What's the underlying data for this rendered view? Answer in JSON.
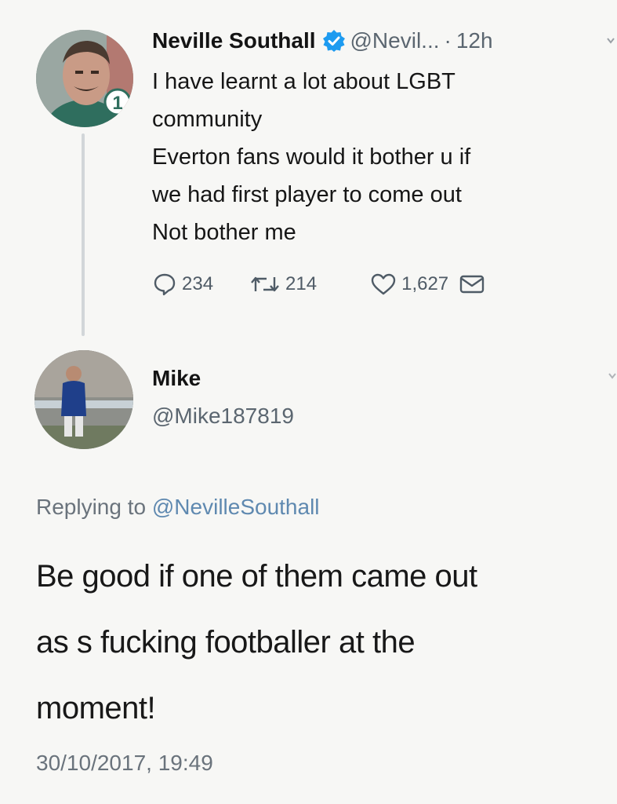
{
  "original_tweet": {
    "display_name": "Neville Southall",
    "handle": "@Nevil...",
    "separator": "·",
    "age": "12h",
    "verified_icon": "verified-badge-icon",
    "body_lines": [
      "I have learnt a lot about LGBT",
      "community",
      "Everton fans would it bother u if",
      "we had first player to come out",
      "Not bother me"
    ],
    "actions": {
      "reply_count": "234",
      "retweet_count": "214",
      "like_count": "1,627"
    },
    "avatar_badge": "1"
  },
  "reply_tweet": {
    "display_name": "Mike",
    "handle": "@Mike187819",
    "replying_prefix": "Replying to",
    "replying_to": "@NevilleSouthall",
    "body_lines": [
      "Be good if one of them came out",
      "as s fucking footballer at the",
      "moment!"
    ],
    "timestamp": "30/10/2017, 19:49"
  },
  "colors": {
    "background": "#f7f7f5",
    "verified_blue": "#1d9bf0",
    "mention_blue": "#5f89b0",
    "secondary_text": "#5b6670"
  }
}
